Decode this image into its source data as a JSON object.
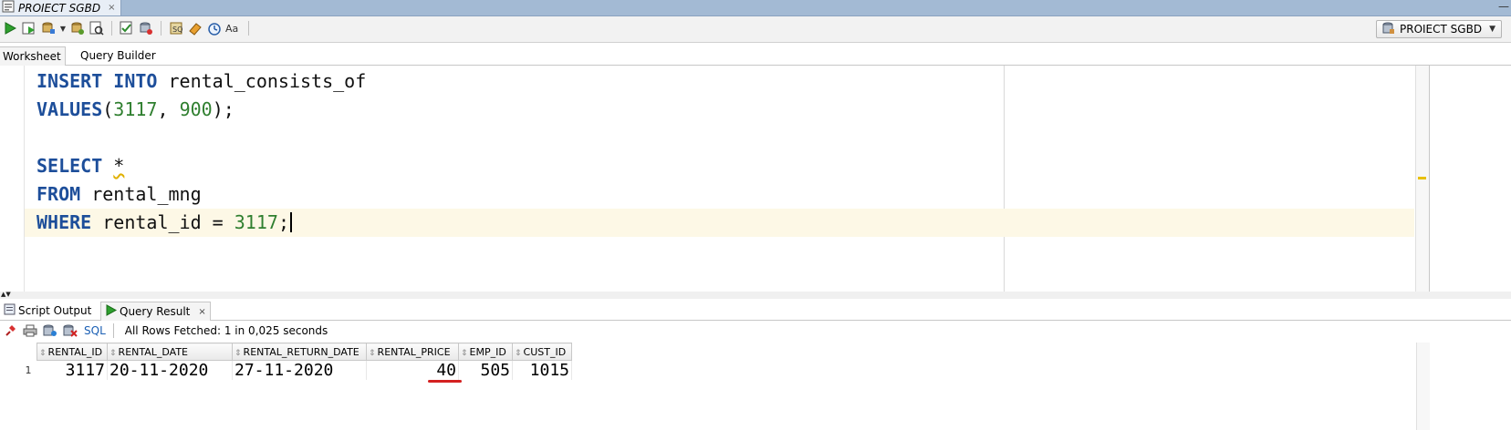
{
  "window": {
    "tab_title": "PROIECT SGBD",
    "tab_close": "×",
    "minimize": "—"
  },
  "toolbar": {
    "icons": [
      "run-statement-icon",
      "run-script-icon",
      "commit-icon",
      "rollback-icon",
      "autotrace-icon",
      "explain-plan-icon",
      "sql-tuning-icon",
      "clear-icon",
      "history-icon",
      "format-icon"
    ],
    "connection": "PROIECT SGBD"
  },
  "worksheet_tabs": {
    "worksheet": "Worksheet",
    "query_builder": "Query Builder"
  },
  "editor": {
    "line1_kw1": "INSERT",
    "line1_kw2": "INTO",
    "line1_rest": " rental_consists_of",
    "line2_kw": "VALUES",
    "line2_open": "(",
    "line2_n1": "3117",
    "line2_comma": ", ",
    "line2_n2": "900",
    "line2_close": ");",
    "line4_kw": "SELECT",
    "line4_star": "*",
    "line5_kw": "FROM",
    "line5_rest": " rental_mng",
    "line6_kw": "WHERE",
    "line6_rest": " rental_id = ",
    "line6_num": "3117",
    "line6_end": ";"
  },
  "results": {
    "tab_script_output": "Script Output",
    "tab_query_result": "Query Result",
    "close": "×",
    "sql_link": "SQL",
    "status": "All Rows Fetched: 1 in 0,025 seconds",
    "columns": [
      "RENTAL_ID",
      "RENTAL_DATE",
      "RENTAL_RETURN_DATE",
      "RENTAL_PRICE",
      "EMP_ID",
      "CUST_ID"
    ],
    "rows": [
      {
        "num": "1",
        "rental_id": "3117",
        "rental_date": "20-11-2020",
        "return_date": "27-11-2020",
        "price": "40",
        "emp_id": "505",
        "cust_id": "1015"
      }
    ]
  },
  "colors": {
    "keyword": "#1d4e9a",
    "number": "#2f7f2f",
    "underline_mark": "#d42020"
  }
}
